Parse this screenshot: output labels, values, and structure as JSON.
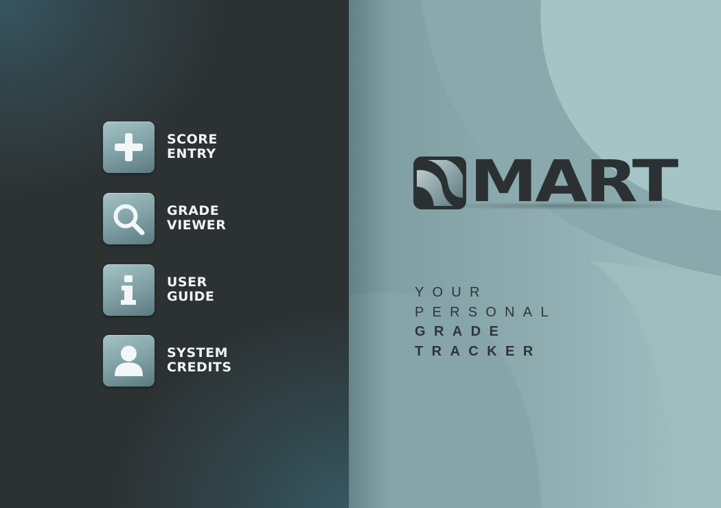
{
  "app": {
    "brand": "MART",
    "brand_initial": "S"
  },
  "menu": {
    "items": [
      {
        "id": "score-entry",
        "icon": "plus-icon",
        "line1": "SCORE",
        "line2": "ENTRY"
      },
      {
        "id": "grade-viewer",
        "icon": "magnifier-icon",
        "line1": "GRADE",
        "line2": "VIEWER"
      },
      {
        "id": "user-guide",
        "icon": "info-icon",
        "line1": "USER",
        "line2": "GUIDE"
      },
      {
        "id": "system-credits",
        "icon": "person-icon",
        "line1": "SYSTEM",
        "line2": "CREDITS"
      }
    ]
  },
  "tagline": {
    "line1": "YOUR",
    "line2": "PERSONAL",
    "line3": "GRADE",
    "line4": "TRACKER"
  },
  "colors": {
    "left_panel_base": "#2c3132",
    "left_panel_accent": "#375560",
    "right_panel_base": "#8fadb1",
    "tile": "#88a8ac",
    "tile_icon": "#f2f6f6",
    "logo_text": "#2b3133",
    "menu_text": "#f0f4f4"
  }
}
